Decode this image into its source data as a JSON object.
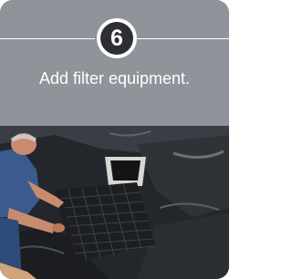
{
  "step": {
    "number": "6",
    "caption": "Add filter equipment."
  },
  "photo": {
    "subject": "photo-man-placing-filter-grid-on-pond-liner"
  },
  "colors": {
    "header_bg": "#8f949a",
    "badge_bg": "#2d2f33",
    "text": "#ffffff"
  }
}
